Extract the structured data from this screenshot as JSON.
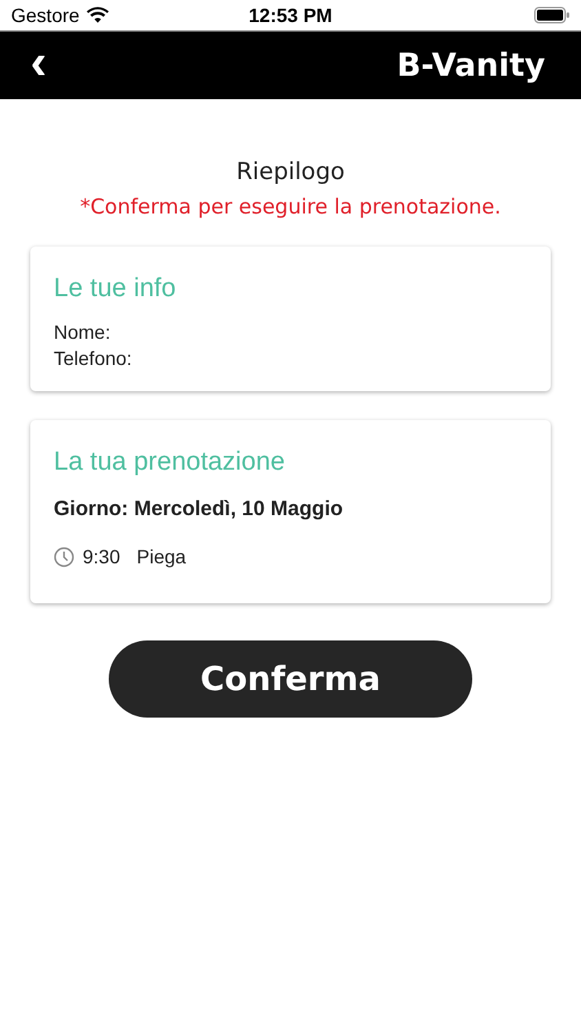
{
  "status_bar": {
    "carrier": "Gestore",
    "time": "12:53 PM"
  },
  "nav_bar": {
    "back": "‹",
    "title": "B-Vanity"
  },
  "summary": {
    "title": "Riepilogo",
    "notice": "*Conferma per eseguire la prenotazione."
  },
  "info_card": {
    "title": "Le tue info",
    "fields": [
      "Nome:",
      "Telefono:"
    ]
  },
  "booking_card": {
    "title": "La tua prenotazione",
    "day": "Giorno: Mercoledì, 10 Maggio",
    "services": [
      {
        "time": "9:30",
        "name": "Piega"
      }
    ]
  },
  "confirm_button": "Conferma"
}
